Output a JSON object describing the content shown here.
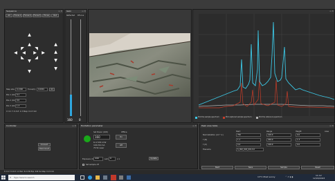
{
  "panels": {
    "sequence": {
      "title": "Sequence"
    },
    "gain": {
      "title": "Gain"
    },
    "spectrum": {
      "title": ""
    },
    "controller": {
      "title": "Controller"
    },
    "excitation": {
      "title": "Excitation parameter"
    },
    "peak": {
      "title": "Peak area table"
    }
  },
  "sequence": {
    "tabs": [
      "All",
      "Focus 1",
      "Focus 2",
      "Focus 3",
      "Focus",
      "Out"
    ],
    "step_label": "Step size:",
    "step_value": "0.1300",
    "focus_label": "Focus(h):",
    "focus_value": "0.0001",
    "rows": [
      "Pos 1 (mm):",
      "Pos 2 (mm):",
      "Pos 3 (mm):"
    ],
    "pos_values": [
      "0.1",
      "0.0",
      "1.3"
    ],
    "status_line": "X: 0.1 Y: 0.0 Z: 1.3 Step: 0.13 mm"
  },
  "gain": {
    "tab_a": "Reflected",
    "tab_b": "RFocus",
    "value_a": "160",
    "value_b": "0",
    "fill_a": 0.22,
    "fill_b": 0.0
  },
  "spectrum": {
    "legend": [
      "Plot the sample spectrum",
      "Plot captured sample spectrum",
      "Plot the reference spectrum"
    ]
  },
  "controller": {
    "connect_label": "Connect",
    "disconnect_label": "Disconnect"
  },
  "excitation": {
    "power_label": "Set Power (mW)",
    "power_value": "160",
    "heading": "Offline",
    "on_label": "On",
    "off_label": "Off",
    "reading_1": "6.4 533 mW",
    "reading_2": "100.39 mA",
    "reading_3": "75.54 Laser",
    "exposure_label": "Exposure (ms):",
    "exposure_value": "440",
    "lam_label": "Lam",
    "lam_value": "0",
    "times": "x 1",
    "update_label": "Update",
    "checkbox_label": "Set sample off",
    "status_color": "#1aa81a"
  },
  "peak": {
    "columns": [
      "Start",
      "Range",
      "Height",
      "Area"
    ],
    "rows": [
      {
        "name": "Normalization (cm^-1)",
        "start": "750",
        "range": "100.0",
        "height": "0.0"
      },
      {
        "name": "Γ (N)",
        "start": "1.1",
        "range": "200.0",
        "height": "1.3"
      },
      {
        "name": "Γ (P)",
        "start": "0.4",
        "range": "100.0",
        "height": "0.0"
      }
    ],
    "filename_label": "Filename",
    "filename_value": "S_002_018_001.txt",
    "buttons": [
      "Start",
      "Save",
      "Sample",
      "Reset"
    ]
  },
  "statusbar": {
    "text": "X: 0.1 Y: 0.0 Z: 1.3  Pwr: 6.4 mW  Exp: 440 ms  Step: 0.13 mm"
  },
  "taskbar": {
    "search_placeholder": "Type here to search",
    "weather": "13°C  Most sunny",
    "time": "11:12",
    "date": "12/03/2023"
  },
  "colors": {
    "sample_spectrum": "#3cc8e6",
    "captured_spectrum": "#c83c28",
    "reference_spectrum": "#b4b4b4"
  }
}
